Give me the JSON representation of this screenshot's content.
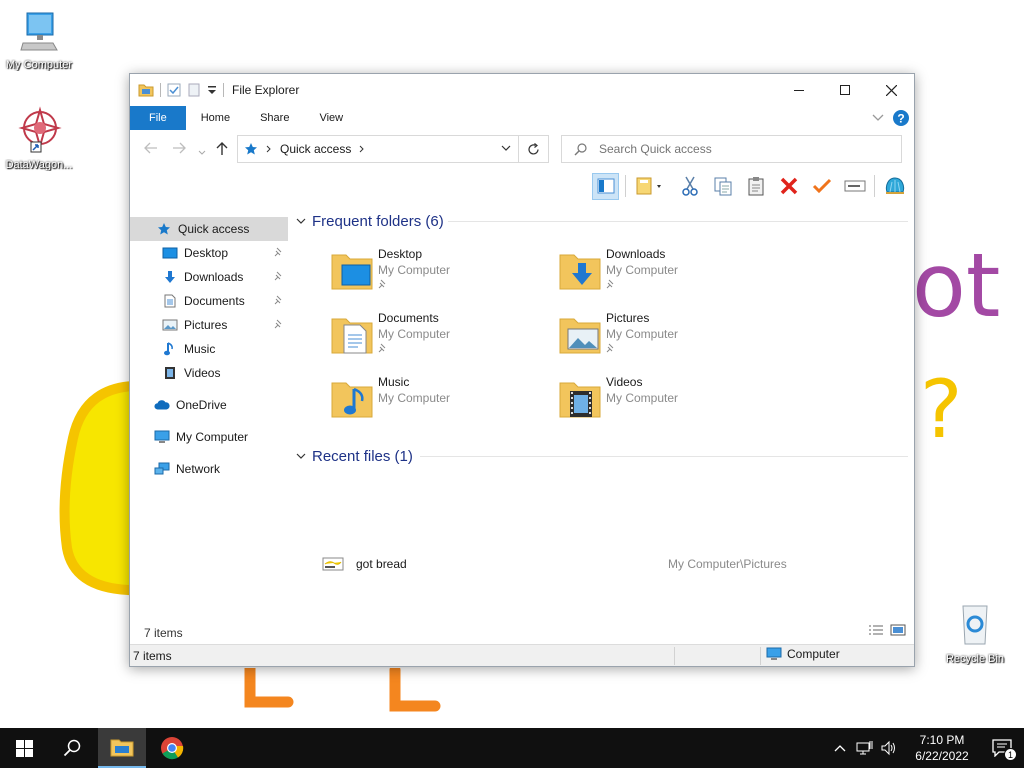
{
  "desktop": {
    "icons": [
      {
        "label": "My Computer"
      },
      {
        "label": "DataWagon..."
      },
      {
        "label": "Recycle Bin"
      }
    ],
    "wallpaper_fragments": [
      "ot",
      "?"
    ]
  },
  "window": {
    "title": "File Explorer",
    "ribbon_tabs": [
      "File",
      "Home",
      "Share",
      "View"
    ],
    "address": {
      "location": "Quick access"
    },
    "search": {
      "placeholder": "Search Quick access"
    },
    "nav_pane": [
      {
        "label": "Quick access",
        "icon": "quick-access-star-icon",
        "pinned": false
      },
      {
        "label": "Desktop",
        "icon": "desktop-icon",
        "pinned": true
      },
      {
        "label": "Downloads",
        "icon": "downloads-icon",
        "pinned": true
      },
      {
        "label": "Documents",
        "icon": "documents-icon",
        "pinned": true
      },
      {
        "label": "Pictures",
        "icon": "pictures-icon",
        "pinned": true
      },
      {
        "label": "Music",
        "icon": "music-icon",
        "pinned": false
      },
      {
        "label": "Videos",
        "icon": "videos-icon",
        "pinned": false
      },
      {
        "label": "OneDrive",
        "icon": "onedrive-cloud-icon",
        "pinned": false
      },
      {
        "label": "My Computer",
        "icon": "computer-icon",
        "pinned": false
      },
      {
        "label": "Network",
        "icon": "network-icon",
        "pinned": false
      }
    ],
    "frequent_header": "Frequent folders (6)",
    "frequent_folders": [
      {
        "name": "Desktop",
        "location": "My Computer",
        "pinned": true
      },
      {
        "name": "Downloads",
        "location": "My Computer",
        "pinned": true
      },
      {
        "name": "Documents",
        "location": "My Computer",
        "pinned": true
      },
      {
        "name": "Pictures",
        "location": "My Computer",
        "pinned": true
      },
      {
        "name": "Music",
        "location": "My Computer",
        "pinned": false
      },
      {
        "name": "Videos",
        "location": "My Computer",
        "pinned": false
      }
    ],
    "recent_header": "Recent files (1)",
    "recent_files": [
      {
        "name": "got bread",
        "path": "My Computer\\Pictures"
      }
    ],
    "item_count": "7 items",
    "status": {
      "left": "7 items",
      "right": "Computer"
    }
  },
  "taskbar": {
    "time": "7:10 PM",
    "date": "6/22/2022",
    "notification_count": "1"
  },
  "colors": {
    "accent": "#1979ca",
    "group_header": "#1e3287",
    "folder": "#f2c55c"
  }
}
